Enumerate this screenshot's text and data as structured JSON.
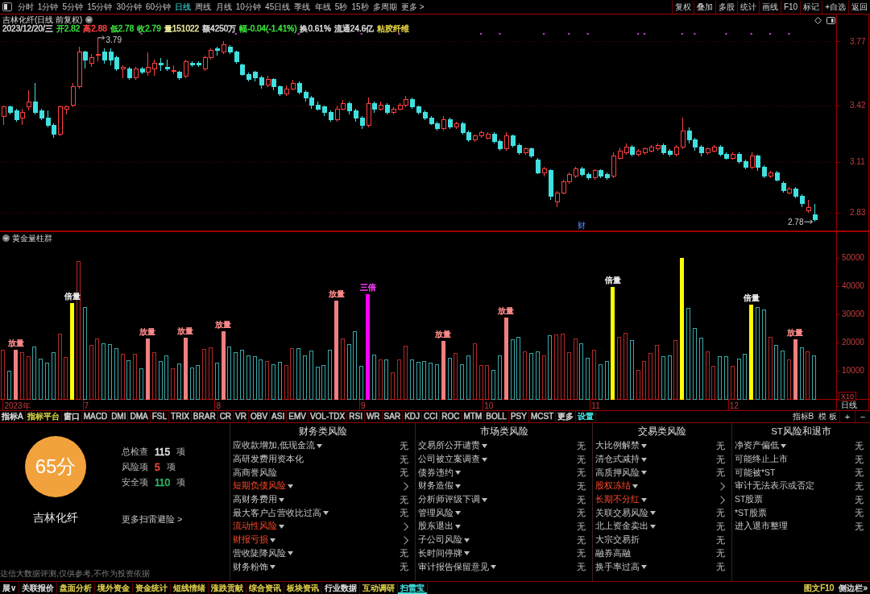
{
  "toolbar": {
    "periods": [
      {
        "label": "分时",
        "selected": false
      },
      {
        "label": "1分钟",
        "selected": false
      },
      {
        "label": "5分钟",
        "selected": false
      },
      {
        "label": "15分钟",
        "selected": false
      },
      {
        "label": "30分钟",
        "selected": false
      },
      {
        "label": "60分钟",
        "selected": false
      },
      {
        "label": "日线",
        "selected": true
      },
      {
        "label": "周线",
        "selected": false
      },
      {
        "label": "月线",
        "selected": false
      },
      {
        "label": "10分钟",
        "selected": false
      },
      {
        "label": "45日线",
        "selected": false
      },
      {
        "label": "季线",
        "selected": false
      },
      {
        "label": "年线",
        "selected": false
      },
      {
        "label": "5秒",
        "selected": false
      },
      {
        "label": "15秒",
        "selected": false
      },
      {
        "label": "多周期",
        "selected": false
      }
    ],
    "more": "更多 >",
    "buttons": [
      "复权",
      "叠加",
      "多股",
      "统计",
      "画线",
      "F10",
      "标记",
      "+自选",
      "返回"
    ]
  },
  "price_panel": {
    "title": "吉林化纤(日线 前复权)",
    "quote": [
      {
        "text": "2023/12/20/三",
        "color": "#d8d8d8"
      },
      {
        "text": "开2.82",
        "color": "#3ce03c"
      },
      {
        "text": "高2.88",
        "color": "#ff4040"
      },
      {
        "text": "低2.78",
        "color": "#3ce03c"
      },
      {
        "text": "收2.79",
        "color": "#3ce03c"
      },
      {
        "text": "量151022",
        "color": "#e8e8a0"
      },
      {
        "text": "额4250万",
        "color": "#d8d8d8"
      },
      {
        "text": "幅-0.04(-1.41%)",
        "color": "#3ce03c"
      },
      {
        "text": "换0.61%",
        "color": "#d8d8d8"
      },
      {
        "text": "流通24.6亿",
        "color": "#d8d8d8"
      },
      {
        "text": "粘胶纤维",
        "color": "#e0d040"
      }
    ],
    "event_label": "财",
    "chart_data": [
      {
        "type": "candlestick",
        "ylim": [
          2.73,
          3.92
        ],
        "yticks": [
          3.77,
          3.42,
          3.11,
          2.83
        ],
        "grid": true,
        "annotations": [
          "3.79",
          "2.78"
        ],
        "ohlc": [
          [
            3.36,
            3.42,
            3.31,
            3.41
          ],
          [
            3.41,
            3.42,
            3.37,
            3.38
          ],
          [
            3.39,
            3.4,
            3.33,
            3.34
          ],
          [
            3.35,
            3.4,
            3.31,
            3.38
          ],
          [
            3.41,
            3.5,
            3.39,
            3.44
          ],
          [
            3.44,
            3.54,
            3.37,
            3.38
          ],
          [
            3.39,
            3.4,
            3.34,
            3.35
          ],
          [
            3.35,
            3.39,
            3.3,
            3.31
          ],
          [
            3.31,
            3.32,
            3.24,
            3.26
          ],
          [
            3.26,
            3.42,
            3.25,
            3.41
          ],
          [
            3.4,
            3.42,
            3.37,
            3.41
          ],
          [
            3.42,
            3.54,
            3.41,
            3.52
          ],
          [
            3.52,
            3.74,
            3.51,
            3.71
          ],
          [
            3.71,
            3.72,
            3.62,
            3.67
          ],
          [
            3.65,
            3.7,
            3.63,
            3.68
          ],
          [
            3.7,
            3.79,
            3.66,
            3.7
          ],
          [
            3.71,
            3.73,
            3.65,
            3.67
          ],
          [
            3.71,
            3.73,
            3.64,
            3.67
          ],
          [
            3.68,
            3.69,
            3.61,
            3.62
          ],
          [
            3.62,
            3.64,
            3.57,
            3.63
          ],
          [
            3.62,
            3.63,
            3.56,
            3.57
          ],
          [
            3.57,
            3.63,
            3.56,
            3.62
          ],
          [
            3.62,
            3.63,
            3.59,
            3.6
          ],
          [
            3.6,
            3.71,
            3.58,
            3.63
          ],
          [
            3.62,
            3.67,
            3.58,
            3.65
          ],
          [
            3.65,
            3.68,
            3.61,
            3.64
          ],
          [
            3.63,
            3.67,
            3.61,
            3.62
          ],
          [
            3.61,
            3.64,
            3.59,
            3.61
          ],
          [
            3.6,
            3.61,
            3.56,
            3.57
          ],
          [
            3.58,
            3.67,
            3.57,
            3.66
          ],
          [
            3.65,
            3.66,
            3.63,
            3.64
          ],
          [
            3.65,
            3.66,
            3.63,
            3.64
          ],
          [
            3.62,
            3.69,
            3.61,
            3.68
          ],
          [
            3.68,
            3.73,
            3.67,
            3.72
          ],
          [
            3.73,
            3.74,
            3.69,
            3.72
          ],
          [
            3.71,
            3.77,
            3.7,
            3.75
          ],
          [
            3.74,
            3.75,
            3.7,
            3.71
          ],
          [
            3.71,
            3.72,
            3.65,
            3.66
          ],
          [
            3.64,
            3.65,
            3.58,
            3.59
          ],
          [
            3.59,
            3.6,
            3.55,
            3.56
          ],
          [
            3.6,
            3.61,
            3.55,
            3.57
          ],
          [
            3.57,
            3.58,
            3.51,
            3.53
          ],
          [
            3.53,
            3.58,
            3.52,
            3.56
          ],
          [
            3.56,
            3.57,
            3.5,
            3.52
          ],
          [
            3.52,
            3.53,
            3.47,
            3.48
          ],
          [
            3.48,
            3.53,
            3.47,
            3.51
          ],
          [
            3.51,
            3.56,
            3.5,
            3.54
          ],
          [
            3.54,
            3.55,
            3.48,
            3.49
          ],
          [
            3.49,
            3.5,
            3.44,
            3.46
          ],
          [
            3.46,
            3.47,
            3.4,
            3.42
          ],
          [
            3.42,
            3.44,
            3.39,
            3.4
          ],
          [
            3.41,
            3.42,
            3.36,
            3.38
          ],
          [
            3.38,
            3.39,
            3.33,
            3.34
          ],
          [
            3.34,
            3.42,
            3.33,
            3.4
          ],
          [
            3.4,
            3.45,
            3.39,
            3.43
          ],
          [
            3.43,
            3.44,
            3.37,
            3.39
          ],
          [
            3.39,
            3.4,
            3.33,
            3.35
          ],
          [
            3.35,
            3.36,
            3.29,
            3.31
          ],
          [
            3.31,
            3.46,
            3.3,
            3.43
          ],
          [
            3.43,
            3.44,
            3.38,
            3.4
          ],
          [
            3.4,
            3.44,
            3.39,
            3.42
          ],
          [
            3.42,
            3.43,
            3.37,
            3.38
          ],
          [
            3.38,
            3.41,
            3.37,
            3.4
          ],
          [
            3.4,
            3.43,
            3.39,
            3.42
          ],
          [
            3.42,
            3.47,
            3.41,
            3.45
          ],
          [
            3.45,
            3.46,
            3.4,
            3.41
          ],
          [
            3.41,
            3.42,
            3.37,
            3.38
          ],
          [
            3.38,
            3.39,
            3.34,
            3.35
          ],
          [
            3.35,
            3.36,
            3.31,
            3.32
          ],
          [
            3.32,
            3.33,
            3.28,
            3.29
          ],
          [
            3.29,
            3.36,
            3.28,
            3.34
          ],
          [
            3.34,
            3.35,
            3.29,
            3.3
          ],
          [
            3.3,
            3.33,
            3.29,
            3.32
          ],
          [
            3.32,
            3.33,
            3.26,
            3.27
          ],
          [
            3.27,
            3.28,
            3.22,
            3.23
          ],
          [
            3.23,
            3.26,
            3.22,
            3.25
          ],
          [
            3.25,
            3.28,
            3.24,
            3.27
          ],
          [
            3.24,
            3.27,
            3.23,
            3.26
          ],
          [
            3.26,
            3.27,
            3.21,
            3.22
          ],
          [
            3.22,
            3.23,
            3.17,
            3.18
          ],
          [
            3.18,
            3.27,
            3.17,
            3.25
          ],
          [
            3.25,
            3.26,
            3.19,
            3.2
          ],
          [
            3.2,
            3.21,
            3.15,
            3.16
          ],
          [
            3.16,
            3.19,
            3.15,
            3.18
          ],
          [
            3.18,
            3.19,
            3.13,
            3.14
          ],
          [
            3.12,
            3.13,
            3.04,
            3.05
          ],
          [
            3.05,
            3.08,
            3.03,
            3.07
          ],
          [
            3.06,
            3.07,
            2.9,
            2.92
          ],
          [
            2.89,
            2.95,
            2.86,
            2.94
          ],
          [
            2.94,
            3.01,
            2.93,
            3.0
          ],
          [
            3.0,
            3.05,
            2.99,
            3.04
          ],
          [
            3.03,
            3.08,
            3.02,
            3.07
          ],
          [
            3.07,
            3.08,
            3.03,
            3.04
          ],
          [
            3.04,
            3.05,
            3.01,
            3.02
          ],
          [
            3.02,
            3.07,
            3.01,
            3.06
          ],
          [
            3.06,
            3.07,
            3.02,
            3.03
          ],
          [
            3.04,
            3.05,
            3.01,
            3.02
          ],
          [
            3.03,
            3.16,
            3.02,
            3.14
          ],
          [
            3.13,
            3.19,
            3.12,
            3.17
          ],
          [
            3.16,
            3.21,
            3.15,
            3.19
          ],
          [
            3.19,
            3.2,
            3.14,
            3.15
          ],
          [
            3.15,
            3.18,
            3.14,
            3.17
          ],
          [
            3.16,
            3.19,
            3.15,
            3.18
          ],
          [
            3.17,
            3.2,
            3.16,
            3.19
          ],
          [
            3.18,
            3.21,
            3.17,
            3.2
          ],
          [
            3.2,
            3.21,
            3.15,
            3.16
          ],
          [
            3.17,
            3.18,
            3.14,
            3.15
          ],
          [
            3.15,
            3.2,
            3.14,
            3.19
          ],
          [
            3.19,
            3.35,
            3.18,
            3.28
          ],
          [
            3.28,
            3.3,
            3.21,
            3.23
          ],
          [
            3.23,
            3.24,
            3.17,
            3.19
          ],
          [
            3.19,
            3.2,
            3.14,
            3.16
          ],
          [
            3.16,
            3.19,
            3.15,
            3.18
          ],
          [
            3.17,
            3.2,
            3.16,
            3.19
          ],
          [
            3.19,
            3.2,
            3.14,
            3.15
          ],
          [
            3.15,
            3.16,
            3.12,
            3.13
          ],
          [
            3.13,
            3.16,
            3.12,
            3.15
          ],
          [
            3.15,
            3.16,
            3.1,
            3.11
          ],
          [
            3.11,
            3.12,
            3.07,
            3.08
          ],
          [
            3.08,
            3.16,
            3.07,
            3.14
          ],
          [
            3.14,
            3.15,
            3.06,
            3.08
          ],
          [
            3.08,
            3.09,
            3.02,
            3.03
          ],
          [
            3.03,
            3.06,
            3.02,
            3.05
          ],
          [
            3.05,
            3.06,
            3.0,
            3.01
          ],
          [
            2.99,
            3.0,
            2.94,
            2.95
          ],
          [
            2.94,
            2.97,
            2.93,
            2.96
          ],
          [
            2.96,
            2.97,
            2.91,
            2.92
          ],
          [
            2.92,
            2.93,
            2.86,
            2.88
          ],
          [
            2.84,
            2.9,
            2.83,
            2.86
          ],
          [
            2.82,
            2.88,
            2.78,
            2.79
          ],
          null,
          null,
          null
        ]
      }
    ]
  },
  "volume_panel": {
    "title": "黄金量柱群",
    "period_label": "日线",
    "unit_label": "X10",
    "solid_bars": [
      false,
      false,
      true,
      false,
      false,
      false,
      false,
      false,
      false,
      false,
      false,
      true,
      false,
      false,
      false,
      false,
      false,
      false,
      false,
      false,
      false,
      false,
      false,
      true,
      false,
      false,
      false,
      false,
      false,
      true,
      false,
      false,
      false,
      false,
      false,
      true,
      false,
      false,
      false,
      false,
      false,
      false,
      false,
      false,
      false,
      false,
      false,
      false,
      false,
      false,
      false,
      false,
      false,
      true,
      false,
      false,
      false,
      false,
      true,
      false,
      false,
      false,
      false,
      false,
      false,
      false,
      false,
      false,
      false,
      false,
      true,
      false,
      false,
      false,
      false,
      false,
      false,
      false,
      false,
      false,
      true,
      false,
      false,
      false,
      false,
      false,
      false,
      false,
      false,
      false,
      false,
      false,
      false,
      false,
      false,
      false,
      false,
      true,
      false,
      false,
      false,
      false,
      false,
      false,
      false,
      false,
      false,
      false,
      true,
      false,
      false,
      false,
      false,
      false,
      false,
      false,
      false,
      false,
      false,
      true,
      false,
      false,
      false,
      false,
      false,
      false,
      true,
      false,
      false,
      false
    ],
    "label_styles": [
      {
        "color": "#ff8c8c"
      },
      {
        "color": "#e8e8e8"
      },
      {
        "color": "#ff8c8c"
      },
      {
        "color": "#ff8c8c"
      },
      {
        "color": "#ff8c8c"
      },
      {
        "color": "#ff8c8c"
      },
      {
        "color": "#ff40ff"
      },
      {
        "color": "#ff8c8c"
      },
      {
        "color": "#ff8c8c"
      },
      {
        "color": "#e8e8e8"
      },
      {
        "color": "#e8e8e8"
      },
      {
        "color": "#ff8c8c"
      }
    ],
    "chart_data": [
      {
        "type": "bar",
        "ylim": [
          0,
          59200
        ],
        "yticks": [
          50000,
          40000,
          30000,
          20000,
          10000
        ],
        "categories": [
          null,
          null,
          "2023年",
          null,
          null,
          null,
          null,
          null,
          null,
          null,
          null,
          null,
          null,
          "7",
          null,
          null,
          null,
          null,
          null,
          null,
          null,
          null,
          null,
          null,
          null,
          null,
          null,
          null,
          null,
          null,
          null,
          null,
          null,
          null,
          "8",
          null,
          null,
          null,
          null,
          null,
          null,
          null,
          null,
          null,
          null,
          null,
          null,
          null,
          null,
          null,
          null,
          null,
          null,
          null,
          null,
          null,
          null,
          "9",
          null,
          null,
          null,
          null,
          null,
          null,
          null,
          null,
          null,
          null,
          null,
          null,
          null,
          null,
          null,
          null,
          null,
          null,
          null,
          "10",
          null,
          null,
          null,
          null,
          null,
          null,
          null,
          null,
          null,
          null,
          null,
          null,
          null,
          null,
          null,
          null,
          "11",
          null,
          null,
          null,
          null,
          null,
          null,
          null,
          null,
          null,
          null,
          null,
          null,
          null,
          null,
          null,
          null,
          null,
          null,
          null,
          null,
          null,
          "12",
          null,
          null,
          null,
          null,
          null,
          null,
          null,
          null,
          null,
          null,
          null,
          null,
          null
        ],
        "values": [
          17300,
          9900,
          17400,
          16500,
          15000,
          18500,
          14200,
          12800,
          16600,
          23100,
          14700,
          34000,
          48900,
          32500,
          19000,
          21400,
          19800,
          19300,
          17900,
          15900,
          13600,
          15900,
          10900,
          21400,
          16500,
          13300,
          15500,
          10800,
          12500,
          21800,
          11000,
          12000,
          17800,
          18200,
          12900,
          23900,
          18600,
          16500,
          17400,
          15500,
          15100,
          14100,
          13500,
          12200,
          13100,
          12000,
          18000,
          18000,
          15300,
          17200,
          11400,
          12000,
          17400,
          34700,
          21400,
          19400,
          24100,
          11600,
          37200,
          15700,
          14100,
          13900,
          9400,
          13900,
          18800,
          13900,
          13100,
          13300,
          12700,
          12200,
          20600,
          14500,
          16300,
          12200,
          15500,
          19800,
          12000,
          12000,
          10200,
          15300,
          28800,
          21200,
          22100,
          16700,
          16300,
          16700,
          15300,
          22500,
          22700,
          23100,
          16500,
          21400,
          19600,
          14500,
          17400,
          12200,
          13300,
          39600,
          22100,
          23300,
          20800,
          10200,
          13300,
          16300,
          19200,
          15100,
          15300,
          20800,
          50000,
          32100,
          25100,
          21600,
          16900,
          11800,
          15100,
          15100,
          11800,
          14300,
          15900,
          33500,
          32500,
          31600,
          22100,
          19000,
          17100,
          13900,
          21000,
          18200,
          16700,
          15300
        ],
        "colors": [
          "#b42828",
          "#3aa8a8",
          "#f08080",
          "#b42828",
          "#b42828",
          "#3aa8a8",
          "#3aa8a8",
          "#3aa8a8",
          "#3aa8a8",
          "#b42828",
          "#b42828",
          "#ffff00",
          "#b42828",
          "#3aa8a8",
          "#b42828",
          "#b42828",
          "#3aa8a8",
          "#3aa8a8",
          "#3aa8a8",
          "#b42828",
          "#3aa8a8",
          "#b42828",
          "#3aa8a8",
          "#f08080",
          "#b42828",
          "#3aa8a8",
          "#3aa8a8",
          "#b42828",
          "#3aa8a8",
          "#f08080",
          "#3aa8a8",
          "#3aa8a8",
          "#b42828",
          "#b42828",
          "#3aa8a8",
          "#f08080",
          "#3aa8a8",
          "#3aa8a8",
          "#3aa8a8",
          "#3aa8a8",
          "#3aa8a8",
          "#3aa8a8",
          "#b42828",
          "#3aa8a8",
          "#3aa8a8",
          "#b42828",
          "#b42828",
          "#3aa8a8",
          "#3aa8a8",
          "#3aa8a8",
          "#3aa8a8",
          "#3aa8a8",
          "#3aa8a8",
          "#f08080",
          "#b42828",
          "#3aa8a8",
          "#3aa8a8",
          "#3aa8a8",
          "#ff00ff",
          "#3aa8a8",
          "#b42828",
          "#3aa8a8",
          "#b42828",
          "#b42828",
          "#b42828",
          "#3aa8a8",
          "#3aa8a8",
          "#3aa8a8",
          "#3aa8a8",
          "#3aa8a8",
          "#f08080",
          "#3aa8a8",
          "#b42828",
          "#3aa8a8",
          "#3aa8a8",
          "#b42828",
          "#b42828",
          "#b42828",
          "#3aa8a8",
          "#3aa8a8",
          "#f08080",
          "#3aa8a8",
          "#3aa8a8",
          "#b42828",
          "#3aa8a8",
          "#3aa8a8",
          "#b42828",
          "#3aa8a8",
          "#b42828",
          "#b42828",
          "#b42828",
          "#b42828",
          "#3aa8a8",
          "#3aa8a8",
          "#b42828",
          "#3aa8a8",
          "#3aa8a8",
          "#ffff00",
          "#b42828",
          "#b42828",
          "#3aa8a8",
          "#b42828",
          "#b42828",
          "#b42828",
          "#b42828",
          "#3aa8a8",
          "#3aa8a8",
          "#b42828",
          "#ffff00",
          "#3aa8a8",
          "#3aa8a8",
          "#3aa8a8",
          "#b42828",
          "#b42828",
          "#3aa8a8",
          "#3aa8a8",
          "#b42828",
          "#3aa8a8",
          "#3aa8a8",
          "#ffff00",
          "#3aa8a8",
          "#3aa8a8",
          "#b42828",
          "#3aa8a8",
          "#3aa8a8",
          "#b42828",
          "#f08080",
          "#3aa8a8",
          "#b42828",
          "#3aa8a8"
        ],
        "value_labels": [
          null,
          null,
          "放量",
          null,
          null,
          null,
          null,
          null,
          null,
          null,
          null,
          "倍量",
          null,
          null,
          null,
          null,
          null,
          null,
          null,
          null,
          null,
          null,
          null,
          "放量",
          null,
          null,
          null,
          null,
          null,
          "放量",
          null,
          null,
          null,
          null,
          null,
          "放量",
          null,
          null,
          null,
          null,
          null,
          null,
          null,
          null,
          null,
          null,
          null,
          null,
          null,
          null,
          null,
          null,
          null,
          "放量",
          null,
          null,
          null,
          null,
          "三倍",
          null,
          null,
          null,
          null,
          null,
          null,
          null,
          null,
          null,
          null,
          null,
          "放量",
          null,
          null,
          null,
          null,
          null,
          null,
          null,
          null,
          null,
          "放量",
          null,
          null,
          null,
          null,
          null,
          null,
          null,
          null,
          null,
          null,
          null,
          null,
          null,
          null,
          null,
          null,
          "倍量",
          null,
          null,
          null,
          null,
          null,
          null,
          null,
          null,
          null,
          null,
          null,
          null,
          null,
          null,
          null,
          null,
          null,
          null,
          null,
          null,
          null,
          "倍量",
          null,
          null,
          null,
          null,
          null,
          null,
          "放量",
          null,
          null,
          null
        ]
      }
    ]
  },
  "indicator_bar": {
    "tabs": [
      {
        "label": "指标A",
        "color": "#d8d8d8"
      },
      {
        "label": "指标平台",
        "color": "#d4d040"
      },
      {
        "label": "窗口",
        "color": "#d8d8d8"
      },
      {
        "label": "MACD",
        "color": "#c8c8c8"
      },
      {
        "label": "DMI",
        "color": "#c8c8c8"
      },
      {
        "label": "DMA",
        "color": "#c8c8c8"
      },
      {
        "label": "FSL",
        "color": "#c8c8c8"
      },
      {
        "label": "TRIX",
        "color": "#c8c8c8"
      },
      {
        "label": "BRAR",
        "color": "#c8c8c8"
      },
      {
        "label": "CR",
        "color": "#c8c8c8"
      },
      {
        "label": "VR",
        "color": "#c8c8c8"
      },
      {
        "label": "OBV",
        "color": "#c8c8c8"
      },
      {
        "label": "ASI",
        "color": "#c8c8c8"
      },
      {
        "label": "EMV",
        "color": "#c8c8c8"
      },
      {
        "label": "VOL-TDX",
        "color": "#c8c8c8"
      },
      {
        "label": "RSI",
        "color": "#c8c8c8"
      },
      {
        "label": "WR",
        "color": "#c8c8c8"
      },
      {
        "label": "SAR",
        "color": "#c8c8c8"
      },
      {
        "label": "KDJ",
        "color": "#c8c8c8"
      },
      {
        "label": "CCI",
        "color": "#c8c8c8"
      },
      {
        "label": "ROC",
        "color": "#c8c8c8"
      },
      {
        "label": "MTM",
        "color": "#c8c8c8"
      },
      {
        "label": "BOLL",
        "color": "#c8c8c8"
      },
      {
        "label": "PSY",
        "color": "#c8c8c8"
      },
      {
        "label": "MCST",
        "color": "#c8c8c8"
      },
      {
        "label": "更多",
        "color": "#d8d8d8"
      },
      {
        "label": "设置",
        "color": "#40e0e0"
      }
    ],
    "right": [
      "指标B",
      "模 板"
    ],
    "zoom": [
      "+",
      "−"
    ]
  },
  "risk_scan": {
    "score": "65分",
    "stock": "吉林化纤",
    "stats": [
      {
        "label": "总检查",
        "value": "115",
        "unit": "项",
        "kind": "total"
      },
      {
        "label": "风险项",
        "value": "5",
        "unit": "项",
        "kind": "risk"
      },
      {
        "label": "安全项",
        "value": "110",
        "unit": "项",
        "kind": "safe"
      }
    ],
    "more_link": "更多扫雷避险 >",
    "disclaimer": "达信大数据评测,仅供参考,不作为投资依据",
    "columns": [
      {
        "title": "财务类风险",
        "items": [
          {
            "label": "应收款增加,低现金流",
            "expandable": true,
            "risk": false,
            "value": "无"
          },
          {
            "label": "高研发费用资本化",
            "expandable": false,
            "risk": false,
            "value": "无"
          },
          {
            "label": "高商誉风险",
            "expandable": false,
            "risk": false,
            "value": "无"
          },
          {
            "label": "短期负债风险",
            "expandable": true,
            "risk": true
          },
          {
            "label": "高财务费用",
            "expandable": true,
            "risk": false,
            "value": "无"
          },
          {
            "label": "最大客户占营收比过高",
            "expandable": true,
            "risk": false,
            "value": "无"
          },
          {
            "label": "流动性风险",
            "expandable": true,
            "risk": true
          },
          {
            "label": "财报亏损",
            "expandable": true,
            "risk": true
          },
          {
            "label": "营收陡降风险",
            "expandable": true,
            "risk": false,
            "value": "无"
          },
          {
            "label": "财务粉饰",
            "expandable": true,
            "risk": false,
            "value": "无"
          }
        ]
      },
      {
        "title": "市场类风险",
        "items": [
          {
            "label": "交易所公开谴责",
            "expandable": true,
            "risk": false,
            "value": "无"
          },
          {
            "label": "公司被立案调查",
            "expandable": true,
            "risk": false,
            "value": "无"
          },
          {
            "label": "债券违约",
            "expandable": true,
            "risk": false,
            "value": "无"
          },
          {
            "label": "财务造假",
            "expandable": true,
            "risk": false,
            "value": "无"
          },
          {
            "label": "分析师评级下调",
            "expandable": true,
            "risk": false,
            "value": "无"
          },
          {
            "label": "管理风险",
            "expandable": true,
            "risk": false,
            "value": "无"
          },
          {
            "label": "股东退出",
            "expandable": true,
            "risk": false,
            "value": "无"
          },
          {
            "label": "子公司风险",
            "expandable": true,
            "risk": false,
            "value": "无"
          },
          {
            "label": "长时间停牌",
            "expandable": true,
            "risk": false,
            "value": "无"
          },
          {
            "label": "审计报告保留意见",
            "expandable": true,
            "risk": false,
            "value": "无"
          }
        ]
      },
      {
        "title": "交易类风险",
        "items": [
          {
            "label": "大比例解禁",
            "expandable": true,
            "risk": false,
            "value": "无"
          },
          {
            "label": "清仓式减持",
            "expandable": true,
            "risk": false,
            "value": "无"
          },
          {
            "label": "高质押风险",
            "expandable": true,
            "risk": false,
            "value": "无"
          },
          {
            "label": "股权冻结",
            "expandable": true,
            "risk": true
          },
          {
            "label": "长期不分红",
            "expandable": true,
            "risk": true
          },
          {
            "label": "关联交易风险",
            "expandable": true,
            "risk": false,
            "value": "无"
          },
          {
            "label": "北上资金卖出",
            "expandable": true,
            "risk": false,
            "value": "无"
          },
          {
            "label": "大宗交易折",
            "expandable": false,
            "risk": false,
            "value": "无"
          },
          {
            "label": "融券高融",
            "expandable": false,
            "risk": false,
            "value": "无"
          },
          {
            "label": "换手率过高",
            "expandable": true,
            "risk": false,
            "value": "无"
          }
        ]
      },
      {
        "title": "ST风险和退市",
        "items": [
          {
            "label": "净资产偏低",
            "expandable": true,
            "risk": false,
            "value": "无"
          },
          {
            "label": "可能终止上市",
            "expandable": false,
            "risk": false,
            "value": "无"
          },
          {
            "label": "可能被*ST",
            "expandable": false,
            "risk": false,
            "value": "无"
          },
          {
            "label": "审计无法表示或否定",
            "expandable": false,
            "risk": false,
            "value": "无"
          },
          {
            "label": "ST股票",
            "expandable": false,
            "risk": false,
            "value": "无"
          },
          {
            "label": "*ST股票",
            "expandable": false,
            "risk": false,
            "value": "无"
          },
          {
            "label": "进入退市整理",
            "expandable": false,
            "risk": false,
            "value": "无"
          }
        ]
      }
    ]
  },
  "bottom_bar": {
    "tabs": [
      {
        "label": "展∨",
        "selected": false,
        "color": "#d8d8d8"
      },
      {
        "label": "关联报价",
        "selected": false,
        "color": "#d8d8d8"
      },
      {
        "label": "盘面分析",
        "selected": false,
        "color": "#d8c848"
      },
      {
        "label": "境外资金",
        "selected": false,
        "color": "#d8c848"
      },
      {
        "label": "资金统计",
        "selected": false,
        "color": "#d8c848"
      },
      {
        "label": "短线情绪",
        "selected": false,
        "color": "#d8c848"
      },
      {
        "label": "涨跌贡献",
        "selected": false,
        "color": "#d8c848"
      },
      {
        "label": "综合资讯",
        "selected": false,
        "color": "#d8c848"
      },
      {
        "label": "板块资讯",
        "selected": false,
        "color": "#d8c848"
      },
      {
        "label": "行业数据",
        "selected": false,
        "color": "#d8d8d8"
      },
      {
        "label": "互动调研",
        "selected": false,
        "color": "#d8c848"
      },
      {
        "label": "扫雷宝",
        "selected": true,
        "color": "#40e0e0"
      }
    ],
    "right": [
      {
        "label": "图文F10",
        "color": "#e0d050"
      },
      {
        "label": "侧边栏»",
        "color": "#d0d0d0"
      }
    ]
  }
}
